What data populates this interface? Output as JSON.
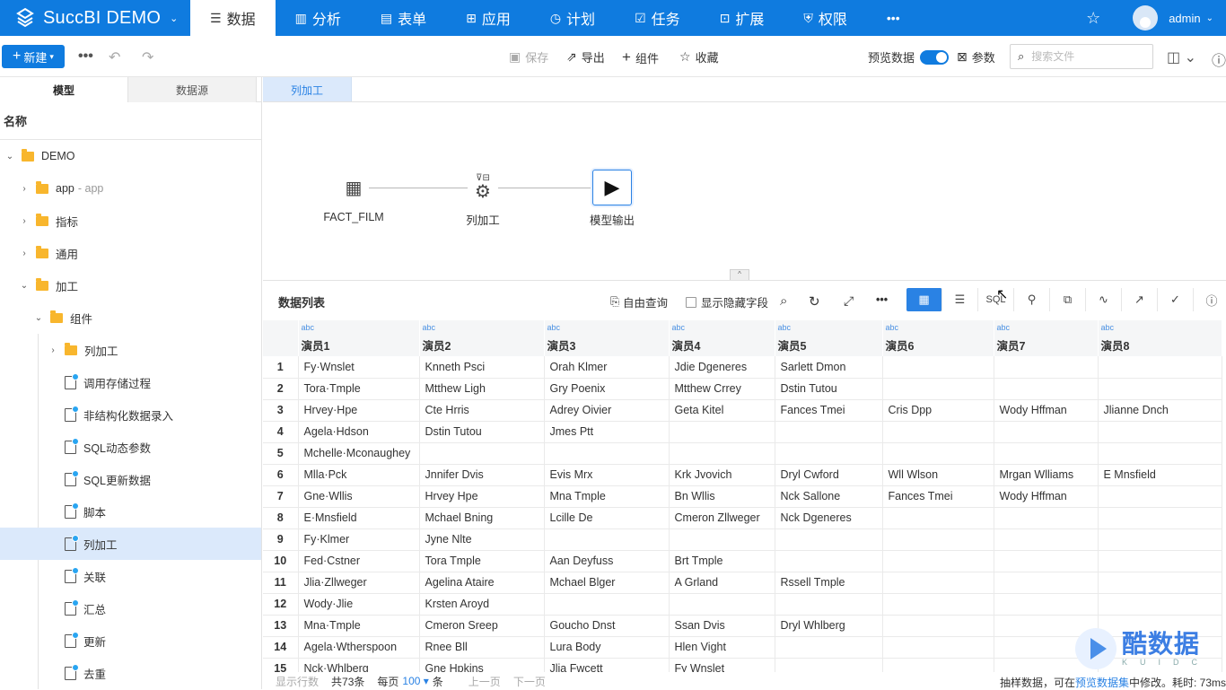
{
  "app": {
    "title": "SuccBI DEMO"
  },
  "nav": [
    {
      "icon": "☰",
      "label": "数据"
    },
    {
      "icon": "▥",
      "label": "分析"
    },
    {
      "icon": "▤",
      "label": "表单"
    },
    {
      "icon": "⊞",
      "label": "应用"
    },
    {
      "icon": "◷",
      "label": "计划"
    },
    {
      "icon": "☑",
      "label": "任务"
    },
    {
      "icon": "⊡",
      "label": "扩展"
    },
    {
      "icon": "⛨",
      "label": "权限"
    },
    {
      "icon": "•••",
      "label": ""
    }
  ],
  "user": {
    "name": "admin"
  },
  "toolbar": {
    "new_label": "新建",
    "save_label": "保存",
    "export_label": "导出",
    "component_label": "组件",
    "favorite_label": "收藏",
    "preview_label": "预览数据",
    "params_label": "参数",
    "search_placeholder": "搜索文件"
  },
  "left": {
    "tabs": [
      "模型",
      "数据源"
    ],
    "header": "名称",
    "tree": [
      {
        "label": "DEMO",
        "sub": "",
        "type": "root"
      },
      {
        "label": "app",
        "sub": "- app",
        "type": "folder"
      },
      {
        "label": "指标",
        "sub": "",
        "type": "folder"
      },
      {
        "label": "通用",
        "sub": "",
        "type": "folder"
      },
      {
        "label": "加工",
        "sub": "",
        "type": "folder"
      },
      {
        "label": "组件",
        "sub": "",
        "type": "folder"
      },
      {
        "label": "列加工",
        "sub": "",
        "type": "folder"
      },
      {
        "label": "调用存储过程",
        "sub": "",
        "type": "doc"
      },
      {
        "label": "非结构化数据录入",
        "sub": "",
        "type": "doc"
      },
      {
        "label": "SQL动态参数",
        "sub": "",
        "type": "doc"
      },
      {
        "label": "SQL更新数据",
        "sub": "",
        "type": "doc"
      },
      {
        "label": "脚本",
        "sub": "",
        "type": "doc"
      },
      {
        "label": "列加工",
        "sub": "",
        "type": "doc"
      },
      {
        "label": "关联",
        "sub": "",
        "type": "doc"
      },
      {
        "label": "汇总",
        "sub": "",
        "type": "doc"
      },
      {
        "label": "更新",
        "sub": "",
        "type": "doc"
      },
      {
        "label": "去重",
        "sub": "",
        "type": "doc"
      }
    ]
  },
  "canvas": {
    "tab": "列加工",
    "nodes": [
      {
        "label": "FACT_FILM"
      },
      {
        "label": "列加工"
      },
      {
        "label": "模型输出"
      }
    ]
  },
  "grid": {
    "title": "数据列表",
    "free_query": "自由查询",
    "show_hidden": "显示隐藏字段",
    "col_type": "abc",
    "columns": [
      "演员1",
      "演员2",
      "演员3",
      "演员4",
      "演员5",
      "演员6",
      "演员7",
      "演员8"
    ],
    "rows": [
      [
        "1",
        "Fy·Wnslet",
        "Knneth Psci",
        "Orah Klmer",
        "Jdie Dgeneres",
        "Sarlett Dmon",
        "",
        "",
        ""
      ],
      [
        "2",
        "Tora·Tmple",
        "Mtthew Ligh",
        "Gry Poenix",
        "Mtthew Crrey",
        "Dstin Tutou",
        "",
        "",
        ""
      ],
      [
        "3",
        "Hrvey·Hpe",
        "Cte Hrris",
        "Adrey Oivier",
        "Geta Kitel",
        "Fances Tmei",
        "Cris Dpp",
        "Wody Hffman",
        "Jlianne Dnch"
      ],
      [
        "4",
        "Agela·Hdson",
        "Dstin Tutou",
        "Jmes Ptt",
        "",
        "",
        "",
        "",
        ""
      ],
      [
        "5",
        "Mchelle·Mconaughey",
        "",
        "",
        "",
        "",
        "",
        "",
        ""
      ],
      [
        "6",
        "Mlla·Pck",
        "Jnnifer Dvis",
        "Evis Mrx",
        "Krk Jvovich",
        "Dryl Cwford",
        "Wll Wlson",
        "Mrgan Wlliams",
        "E Mnsfield"
      ],
      [
        "7",
        "Gne·Wllis",
        "Hrvey Hpe",
        "Mna Tmple",
        "Bn Wllis",
        "Nck Sallone",
        "Fances Tmei",
        "Wody Hffman",
        ""
      ],
      [
        "8",
        "E·Mnsfield",
        "Mchael Bning",
        "Lcille De",
        "Cmeron Zllweger",
        "Nck Dgeneres",
        "",
        "",
        ""
      ],
      [
        "9",
        "Fy·Klmer",
        "Jyne Nlte",
        "",
        "",
        "",
        "",
        "",
        ""
      ],
      [
        "10",
        "Fed·Cstner",
        "Tora Tmple",
        "Aan Deyfuss",
        "Brt Tmple",
        "",
        "",
        "",
        ""
      ],
      [
        "11",
        "Jlia·Zllweger",
        "Agelina Ataire",
        "Mchael Blger",
        "A Grland",
        "Rssell Tmple",
        "",
        "",
        ""
      ],
      [
        "12",
        "Wody·Jlie",
        "Krsten Aroyd",
        "",
        "",
        "",
        "",
        "",
        ""
      ],
      [
        "13",
        "Mna·Tmple",
        "Cmeron Sreep",
        "Goucho Dnst",
        "Ssan Dvis",
        "Dryl Whlberg",
        "",
        "",
        ""
      ],
      [
        "14",
        "Agela·Wtherspoon",
        "Rnee Bll",
        "Lura Body",
        "Hlen Vight",
        "",
        "",
        "",
        ""
      ],
      [
        "15",
        "Nck·Whlberg",
        "Gne Hpkins",
        "Jlia Fwcett",
        "Fy Wnslet",
        "",
        "",
        "",
        ""
      ]
    ]
  },
  "footer": {
    "show_rows": "显示行数",
    "total": "共73条",
    "per_page": "每页",
    "page_size": "100",
    "unit": "条",
    "prev": "上一页",
    "next": "下一页",
    "right_prefix": "抽样数据，可在",
    "right_link": "预览数据集",
    "right_suffix": "中修改。耗时: 73ms"
  },
  "watermark": {
    "text": "酷数据",
    "sub": "KUIDC"
  }
}
